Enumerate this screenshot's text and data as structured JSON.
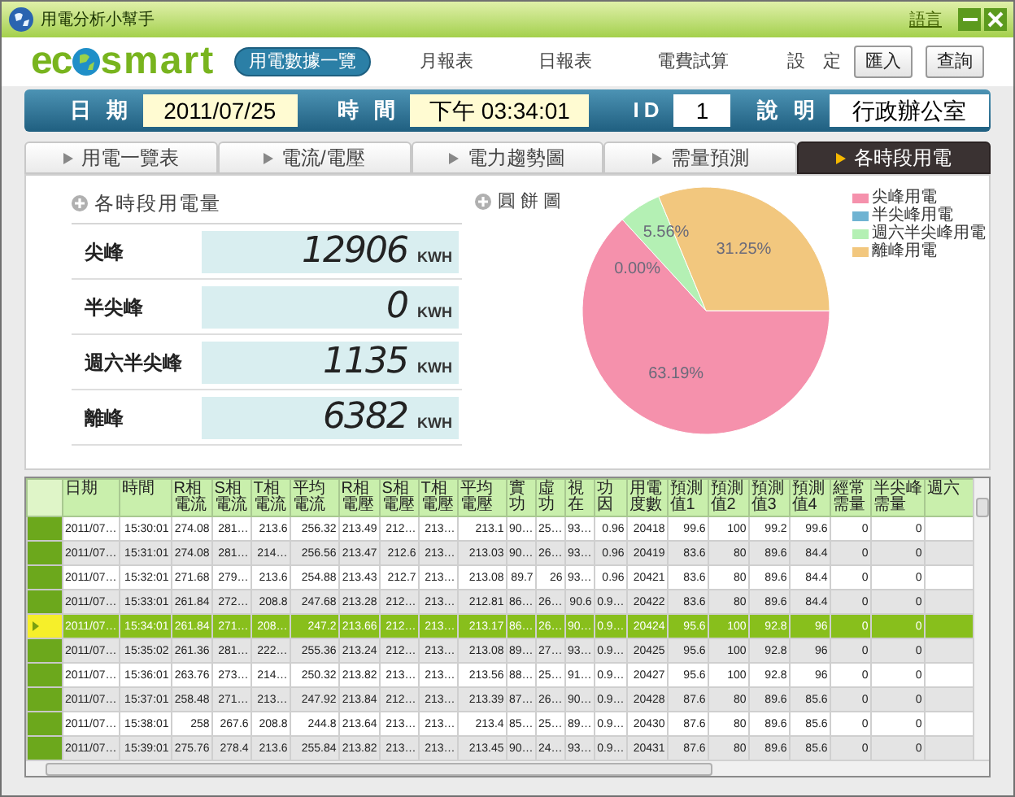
{
  "window": {
    "title": "用電分析小幫手",
    "language_link": "語言"
  },
  "logo": {
    "left": "ec",
    "right": "smart"
  },
  "nav": [
    {
      "label": "用電數據一覽",
      "selected": true
    },
    {
      "label": "月報表",
      "selected": false
    },
    {
      "label": "日報表",
      "selected": false
    },
    {
      "label": "電費試算",
      "selected": false
    },
    {
      "label": "設　定",
      "selected": false
    }
  ],
  "header_buttons": [
    "匯入",
    "查詢"
  ],
  "info_bar": [
    {
      "label": "日 期",
      "value": "2011/07/25",
      "kind": "highlight"
    },
    {
      "label": "時 間",
      "value": "下午 03:34:01",
      "kind": "highlight"
    },
    {
      "label": "ID",
      "value": "1",
      "kind": "plain"
    },
    {
      "label": "說 明",
      "value": "行政辦公室",
      "kind": "plain"
    }
  ],
  "tabs": [
    {
      "label": "用電一覽表",
      "selected": false
    },
    {
      "label": "電流/電壓",
      "selected": false
    },
    {
      "label": "電力趨勢圖",
      "selected": false
    },
    {
      "label": "需量預測",
      "selected": false
    },
    {
      "label": "各時段用電",
      "selected": true
    }
  ],
  "usage_panel": {
    "title": "各時段用電量",
    "rows": [
      {
        "label": "尖峰",
        "value": "12906",
        "unit": "KWH"
      },
      {
        "label": "半尖峰",
        "value": "0",
        "unit": "KWH"
      },
      {
        "label": "週六半尖峰",
        "value": "1135",
        "unit": "KWH"
      },
      {
        "label": "離峰",
        "value": "6382",
        "unit": "KWH"
      }
    ]
  },
  "pie_panel": {
    "title": "圓 餅 圖",
    "chart_data": {
      "type": "pie",
      "categories": [
        "尖峰用電",
        "半尖峰用電",
        "週六半尖峰用電",
        "離峰用電"
      ],
      "series": [
        {
          "values": [
            63.19,
            0.0,
            5.56,
            31.25
          ]
        }
      ],
      "colors": [
        "#f591ac",
        "#6fb3d2",
        "#b4f0b4",
        "#f2c77e"
      ],
      "value_labels": [
        "63.19%",
        "0.00%",
        "5.56%",
        "31.25%"
      ]
    }
  },
  "table": {
    "columns": [
      "日期",
      "時間",
      "R相電流",
      "S相電流",
      "T相電流",
      "平均電流",
      "R相電壓",
      "S相電壓",
      "T相電壓",
      "平均電壓",
      "實功",
      "虛功",
      "視在",
      "功因",
      "用電度數",
      "預測值1",
      "預測值2",
      "預測值3",
      "預測值4",
      "經常需量",
      "半尖峰需量",
      "週六"
    ],
    "rows": [
      {
        "selected": false,
        "cells": [
          "2011/07…",
          "15:30:01",
          "274.08",
          "281…",
          "213.6",
          "256.32",
          "213.49",
          "212…",
          "213…",
          "213.1",
          "90…",
          "25…",
          "93…",
          "0.96",
          "20418",
          "99.6",
          "100",
          "99.2",
          "99.6",
          "0",
          "0"
        ]
      },
      {
        "selected": false,
        "cells": [
          "2011/07…",
          "15:31:01",
          "274.08",
          "281…",
          "214…",
          "256.56",
          "213.47",
          "212.6",
          "213…",
          "213.03",
          "90…",
          "26…",
          "93…",
          "0.96",
          "20419",
          "83.6",
          "80",
          "89.6",
          "84.4",
          "0",
          "0"
        ]
      },
      {
        "selected": false,
        "cells": [
          "2011/07…",
          "15:32:01",
          "271.68",
          "279…",
          "213.6",
          "254.88",
          "213.43",
          "212.7",
          "213…",
          "213.08",
          "89.7",
          "26",
          "93…",
          "0.96",
          "20421",
          "83.6",
          "80",
          "89.6",
          "84.4",
          "0",
          "0"
        ]
      },
      {
        "selected": false,
        "cells": [
          "2011/07…",
          "15:33:01",
          "261.84",
          "272…",
          "208.8",
          "247.68",
          "213.28",
          "212…",
          "213…",
          "212.81",
          "86…",
          "26…",
          "90.6",
          "0.9…",
          "20422",
          "83.6",
          "80",
          "89.6",
          "84.4",
          "0",
          "0"
        ]
      },
      {
        "selected": true,
        "cells": [
          "2011/07…",
          "15:34:01",
          "261.84",
          "271…",
          "208…",
          "247.2",
          "213.66",
          "212…",
          "213…",
          "213.17",
          "86…",
          "26…",
          "90…",
          "0.9…",
          "20424",
          "95.6",
          "100",
          "92.8",
          "96",
          "0",
          "0"
        ]
      },
      {
        "selected": false,
        "cells": [
          "2011/07…",
          "15:35:02",
          "261.36",
          "281…",
          "222…",
          "255.36",
          "213.24",
          "212…",
          "213…",
          "213.08",
          "89…",
          "27…",
          "93…",
          "0.9…",
          "20425",
          "95.6",
          "100",
          "92.8",
          "96",
          "0",
          "0"
        ]
      },
      {
        "selected": false,
        "cells": [
          "2011/07…",
          "15:36:01",
          "263.76",
          "273…",
          "214…",
          "250.32",
          "213.82",
          "213…",
          "213…",
          "213.56",
          "88…",
          "25…",
          "91…",
          "0.9…",
          "20427",
          "95.6",
          "100",
          "92.8",
          "96",
          "0",
          "0"
        ]
      },
      {
        "selected": false,
        "cells": [
          "2011/07…",
          "15:37:01",
          "258.48",
          "271…",
          "213…",
          "247.92",
          "213.84",
          "212…",
          "213…",
          "213.39",
          "87…",
          "26…",
          "90…",
          "0.9…",
          "20428",
          "87.6",
          "80",
          "89.6",
          "85.6",
          "0",
          "0"
        ]
      },
      {
        "selected": false,
        "cells": [
          "2011/07…",
          "15:38:01",
          "258",
          "267.6",
          "208.8",
          "244.8",
          "213.64",
          "213…",
          "213…",
          "213.4",
          "85…",
          "25…",
          "89…",
          "0.9…",
          "20430",
          "87.6",
          "80",
          "89.6",
          "85.6",
          "0",
          "0"
        ]
      },
      {
        "selected": false,
        "cells": [
          "2011/07…",
          "15:39:01",
          "275.76",
          "278.4",
          "213.6",
          "255.84",
          "213.82",
          "213…",
          "213…",
          "213.45",
          "90…",
          "24…",
          "93…",
          "0.9…",
          "20431",
          "87.6",
          "80",
          "89.6",
          "85.6",
          "0",
          "0"
        ]
      }
    ]
  }
}
